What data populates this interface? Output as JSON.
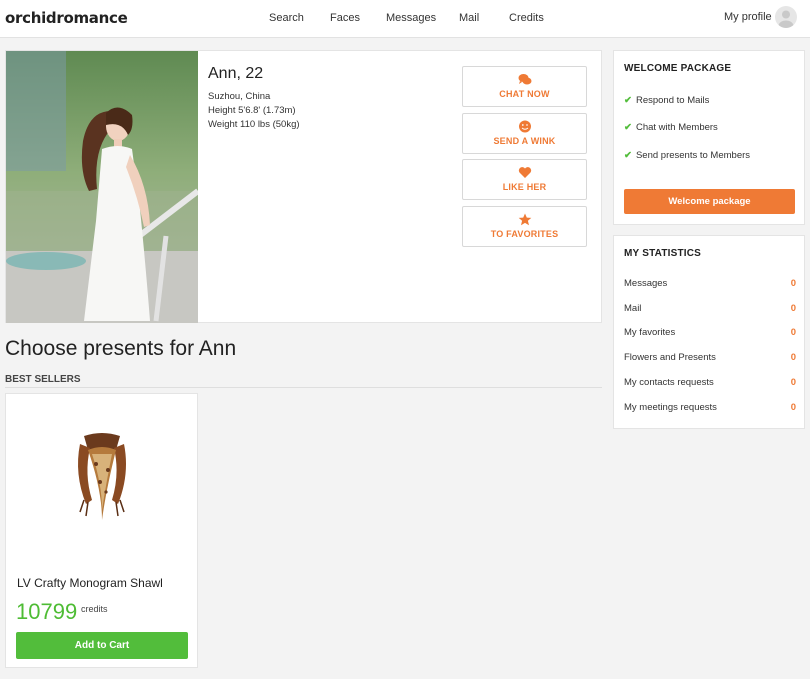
{
  "header": {
    "logo": "orchidromance",
    "nav": [
      "Search",
      "Faces",
      "Messages",
      "Mail",
      "Credits"
    ],
    "profile_label": "My profile"
  },
  "profile": {
    "name_age": "Ann, 22",
    "location": "Suzhou, China",
    "height": "Height 5'6.8' (1.73m)",
    "weight": "Weight 110 lbs (50kg)",
    "actions": {
      "chat": "CHAT NOW",
      "wink": "SEND A WINK",
      "like": "LIKE HER",
      "favorites": "TO FAVORITES"
    }
  },
  "presents": {
    "title": "Choose presents for Ann",
    "section_label": "BEST SELLERS",
    "products": [
      {
        "name": "LV Crafty Monogram Shawl",
        "price": "10799",
        "unit": "credits",
        "button": "Add to Cart"
      }
    ]
  },
  "welcome": {
    "heading": "WELCOME PACKAGE",
    "perks": [
      "Respond to Mails",
      "Chat with Members",
      "Send presents to Members"
    ],
    "button": "Welcome package"
  },
  "stats": {
    "heading": "MY STATISTICS",
    "rows": [
      {
        "label": "Messages",
        "value": "0"
      },
      {
        "label": "Mail",
        "value": "0"
      },
      {
        "label": "My favorites",
        "value": "0"
      },
      {
        "label": "Flowers and Presents",
        "value": "0"
      },
      {
        "label": "My contacts requests",
        "value": "0"
      },
      {
        "label": "My meetings requests",
        "value": "0"
      }
    ]
  },
  "colors": {
    "accent_orange": "#ef7a35",
    "accent_green": "#52bd3b",
    "price_green": "#4ebc34",
    "background": "#f3f3f3"
  }
}
